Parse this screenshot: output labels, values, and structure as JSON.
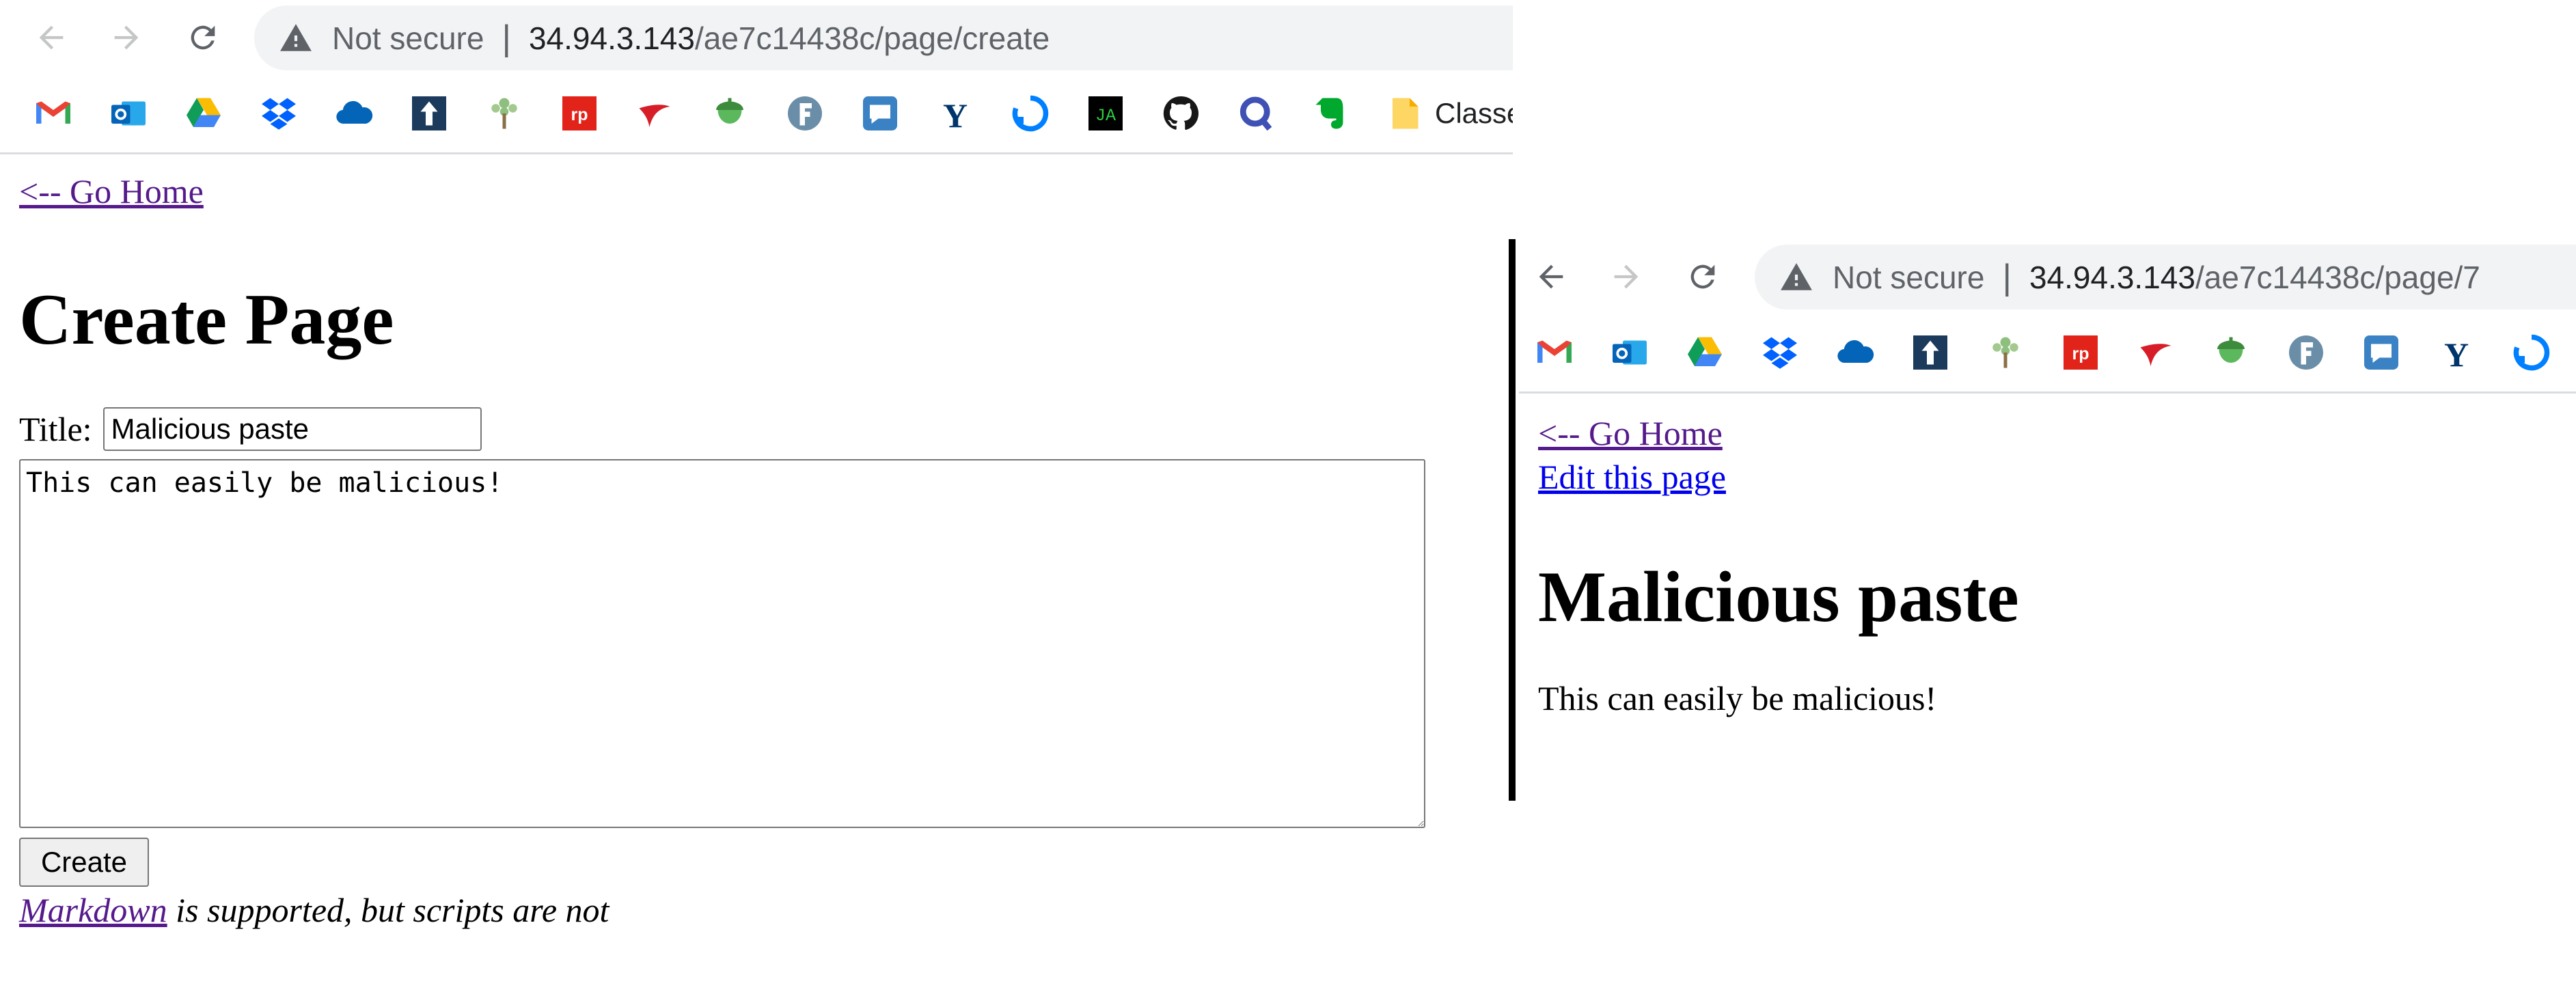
{
  "left": {
    "browser": {
      "security_label": "Not secure",
      "separator": "|",
      "url_host": "34.94.3.143",
      "url_path": "/ae7c14438c/page/create",
      "bookmark_folder_label": "Classe"
    },
    "home_link": "<-- Go Home",
    "heading": "Create Page",
    "title_label": "Title:",
    "title_value": "Malicious paste",
    "body_value": "This can easily be malicious!",
    "create_button": "Create",
    "markdown_link": "Markdown",
    "markdown_note": " is supported, but scripts are not"
  },
  "right": {
    "browser": {
      "security_label": "Not secure",
      "separator": "|",
      "url_host": "34.94.3.143",
      "url_path": "/ae7c14438c/page/7"
    },
    "home_link": "<-- Go Home",
    "edit_link": "Edit this page",
    "heading": "Malicious paste",
    "body_text": "This can easily be malicious!"
  },
  "bookmark_icons": [
    "gmail-icon",
    "outlook-icon",
    "google-drive-icon",
    "dropbox-icon",
    "onedrive-icon",
    "upload-arrow-icon",
    "tree-icon",
    "rp-icon",
    "swoosh-icon",
    "acorn-icon",
    "f-logo-icon",
    "chat-bubble-icon",
    "yale-y-icon",
    "refresh-circle-icon",
    "ja-terminal-icon",
    "github-icon",
    "q-icon",
    "evernote-icon",
    "folder-icon"
  ],
  "colors": {
    "link_visited": "#551a8b",
    "link_unvisited": "#0000ee",
    "omnibox_bg": "#f1f3f4"
  }
}
